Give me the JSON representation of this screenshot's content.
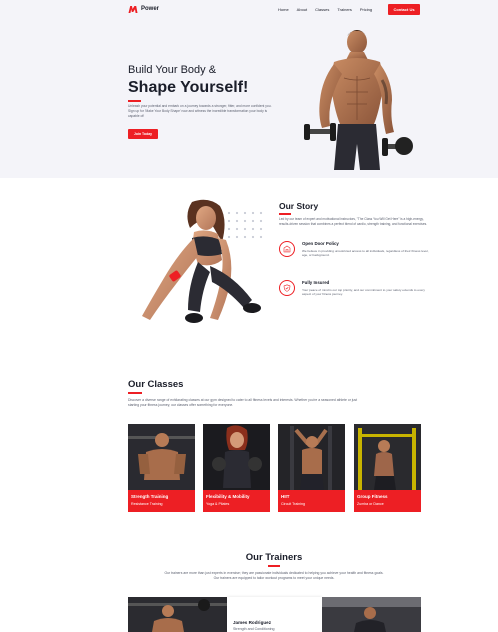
{
  "brand": {
    "name": "Power",
    "accent": "#ed1f24",
    "dark": "#1a1d29"
  },
  "nav": {
    "items": [
      "Home",
      "About",
      "Classes",
      "Trainers",
      "Pricing"
    ],
    "contact_label": "Contact Us"
  },
  "hero": {
    "subtitle": "Build Your Body &",
    "title": "Shape Yourself!",
    "description": "Unleash your potential and embark on a journey towards a stronger, fitter, and more confident you. Sign up for 'Make Your Body Shape' now and witness the incredible transformation your body is capable of!",
    "cta_label": "Join Today"
  },
  "story": {
    "title": "Our Story",
    "text": "Led by our team of expert and motivational instructors, \"The Class You Will Get Here\" is a high-energy, results-driven session that combines a perfect blend of cardio, strength training, and functional exercises.",
    "features": [
      {
        "icon": "door-icon",
        "title": "Open Door Policy",
        "description": "We believe in providing unrestricted access to all individuals, regardless of their fitness level, age, or background."
      },
      {
        "icon": "shield-icon",
        "title": "Fully Insured",
        "description": "Your peace of mind is our top priority, and our commitment to your safety extends to every aspect of your fitness journey."
      }
    ]
  },
  "classes": {
    "title": "Our Classes",
    "description": "Discover a diverse range of exhilarating classes at our gym designed to cater to all fitness levels and interests. Whether you're a seasoned athlete or just starting your fitness journey, our classes offer something for everyone.",
    "items": [
      {
        "name": "Strength Training",
        "sub": "Resistance Training"
      },
      {
        "name": "Flexibility & Mobility",
        "sub": "Yoga & Pilates"
      },
      {
        "name": "HIIT",
        "sub": "Circuit Training"
      },
      {
        "name": "Group Fitness",
        "sub": "Zumba or Dance"
      }
    ]
  },
  "trainers": {
    "title": "Our Trainers",
    "description": "Our trainers are more than just experts in exercise; they are passionate individuals dedicated to helping you achieve your health and fitness goals. Our trainers are equipped to tailor workout programs to meet your unique needs.",
    "items": [
      {
        "name": "James Rodriguez",
        "role": "Strength and Conditioning"
      }
    ]
  }
}
